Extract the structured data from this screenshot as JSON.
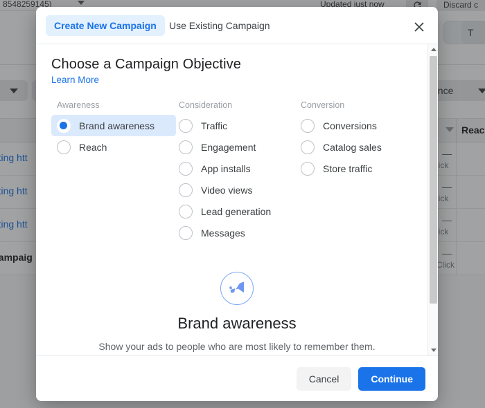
{
  "background": {
    "account_id": "8548259145)",
    "updated_text": "Updated just now",
    "refresh_icon": "refresh-icon",
    "discard_label": "Discard c",
    "toolbar_button_label": "T",
    "filter_dropdown_label": "ance",
    "table": {
      "sort_icon": "sort-descending-icon",
      "header_reach": "Reac",
      "rows": [
        {
          "link": "noting htt",
          "value": "—",
          "sub": "lick"
        },
        {
          "link": "noting htt",
          "value": "—",
          "sub": "lick"
        },
        {
          "link": "noting htt",
          "value": "—",
          "sub": "lick"
        },
        {
          "link": "campaig",
          "value": "—",
          "sub": "Click"
        }
      ]
    }
  },
  "modal": {
    "tabs": [
      {
        "label": "Create New Campaign",
        "active": true
      },
      {
        "label": "Use Existing Campaign",
        "active": false
      }
    ],
    "close_icon": "close-icon",
    "title": "Choose a Campaign Objective",
    "learn_more": "Learn More",
    "columns": [
      {
        "heading": "Awareness",
        "options": [
          {
            "label": "Brand awareness",
            "selected": true
          },
          {
            "label": "Reach",
            "selected": false
          }
        ]
      },
      {
        "heading": "Consideration",
        "options": [
          {
            "label": "Traffic",
            "selected": false
          },
          {
            "label": "Engagement",
            "selected": false
          },
          {
            "label": "App installs",
            "selected": false
          },
          {
            "label": "Video views",
            "selected": false
          },
          {
            "label": "Lead generation",
            "selected": false
          },
          {
            "label": "Messages",
            "selected": false
          }
        ]
      },
      {
        "heading": "Conversion",
        "options": [
          {
            "label": "Conversions",
            "selected": false
          },
          {
            "label": "Catalog sales",
            "selected": false
          },
          {
            "label": "Store traffic",
            "selected": false
          }
        ]
      }
    ],
    "preview": {
      "icon": "megaphone-icon",
      "title": "Brand awareness",
      "description": "Show your ads to people who are most likely to remember them."
    },
    "scrollbar": {
      "up_icon": "scroll-up-arrow-icon",
      "down_icon": "scroll-down-arrow-icon"
    },
    "footer": {
      "cancel_label": "Cancel",
      "continue_label": "Continue"
    }
  },
  "colors": {
    "accent": "#1a73e8",
    "tab_active_bg": "#e3f0fe",
    "selected_row_bg": "#dbe9fd",
    "preview_icon": "#6d97f0"
  }
}
